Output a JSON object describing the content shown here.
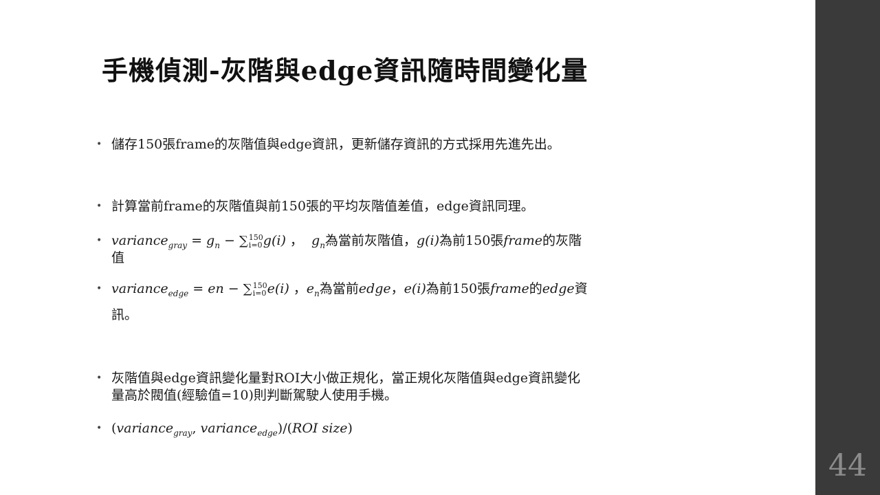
{
  "slide": {
    "title": "手機偵測-灰階與edge資訊隨時間變化量",
    "page_number": "44"
  },
  "bullets": {
    "b1": "儲存150張frame的灰階值與edge資訊，更新儲存資訊的方式採用先進先出。",
    "b2": "計算當前frame的灰階值與前150張的平均灰階值差值，edge資訊同理。",
    "b3": {
      "var": "variance",
      "sub": "gray",
      "eq": " = ",
      "gn": "g",
      "gn_sub": "n",
      "minus": " − ",
      "sum": "∑",
      "sum_top": "150",
      "sum_bottom": "i=0",
      "gi": "g(i)",
      "comma": " ，",
      "gn2": "g",
      "gn2_sub": "n",
      "text1": "為當前灰階值，",
      "gi2": "g(i)",
      "text2": "為前150張",
      "frame": "frame",
      "text3": "的灰階",
      "line2": "值"
    },
    "b4": {
      "var": "variance",
      "sub": "edge",
      "eq": " = ",
      "en": "en",
      "minus": " − ",
      "sum": "∑",
      "sum_top": "150",
      "sum_bottom": "i=0",
      "ei": "e(i)",
      "comma": " ，",
      "en2": "e",
      "en2_sub": "n",
      "text1": "為當前",
      "edge1": "edge",
      "comma2": "，",
      "ei2": "e(i)",
      "text2": "為前150張",
      "frame": "frame",
      "text3": "的",
      "edge2": "edge",
      "text4": "資",
      "line2": "訊。"
    },
    "b5_line1": "灰階值與edge資訊變化量對ROI大小做正規化，當正規化灰階值與edge資訊變化",
    "b5_line2": "量高於閥值(經驗值=10)則判斷駕駛人使用手機。",
    "b6": {
      "open": "(",
      "var1": "variance",
      "sub1": "gray",
      "comma": ", ",
      "var2": "variance",
      "sub2": "edge",
      "close": ")/(",
      "roi": "ROI size",
      "end": ")"
    }
  }
}
